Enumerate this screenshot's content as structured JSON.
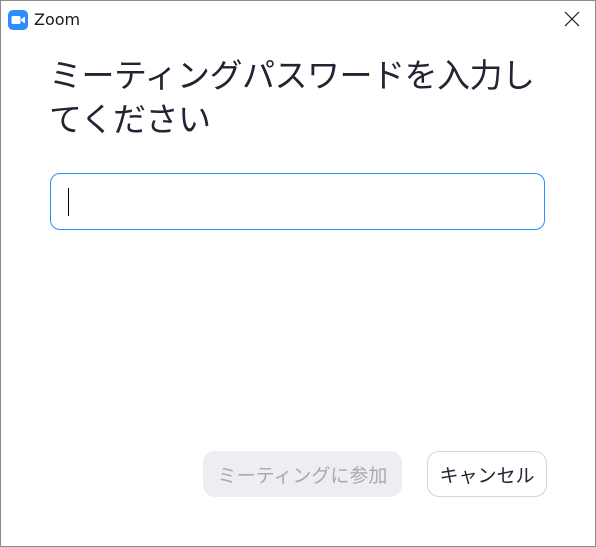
{
  "window": {
    "app_title": "Zoom",
    "app_icon": "zoom-camera-icon",
    "close_icon": "close-icon"
  },
  "dialog": {
    "heading": "ミーティングパスワードを入力してください",
    "password_field": {
      "value": "",
      "placeholder": ""
    },
    "join_button_label": "ミーティングに参加",
    "join_button_state": "disabled",
    "cancel_button_label": "キャンセル"
  },
  "colors": {
    "accent": "#2d8cff",
    "heading_text": "#232333",
    "disabled_button_bg": "#ededf2",
    "disabled_button_text": "#a9a9b5"
  }
}
